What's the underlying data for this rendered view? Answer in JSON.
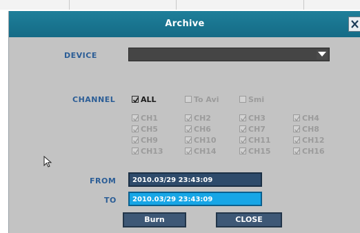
{
  "dialog": {
    "title": "Archive"
  },
  "device": {
    "label": "DEVICE",
    "value": ""
  },
  "channel": {
    "label": "CHANNEL",
    "all": "ALL",
    "to_avi": "To Avi",
    "smi": "Smi",
    "items": [
      "CH1",
      "CH2",
      "CH3",
      "CH4",
      "CH5",
      "CH6",
      "CH7",
      "CH8",
      "CH9",
      "CH10",
      "CH11",
      "CH12",
      "CH13",
      "CH14",
      "CH15",
      "CH16"
    ]
  },
  "range": {
    "from_label": "FROM",
    "from_value": "2010.03/29  23:43:09",
    "to_label": "TO",
    "to_value": "2010.03/29  23:43:09"
  },
  "buttons": {
    "burn": "Burn",
    "close": "CLOSE"
  },
  "colors": {
    "titlebar": "#1e7f9a",
    "label": "#2b5d96",
    "panel": "#c3c3c3",
    "to_field": "#17a6e6"
  }
}
